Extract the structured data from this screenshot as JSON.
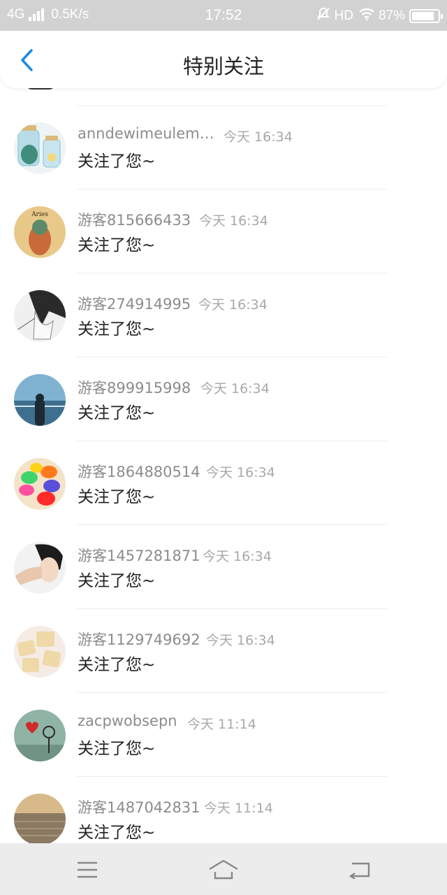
{
  "status_bar": {
    "network": "4G",
    "speed": "0.5K/s",
    "time": "17:52",
    "hd": "HD",
    "battery": "87%",
    "battery_level": 0.87
  },
  "header": {
    "title": "特别关注",
    "back_icon": "chevron-left-icon",
    "accent": "#1a8ce8"
  },
  "notifications": [
    {
      "name": "anndewimeulem…",
      "time": "今天 16:34",
      "message": "关注了您~"
    },
    {
      "name": "游客815666433",
      "time": "今天 16:34",
      "message": "关注了您~"
    },
    {
      "name": "游客274914995",
      "time": "今天 16:34",
      "message": "关注了您~"
    },
    {
      "name": "游客899915998",
      "time": "今天 16:34",
      "message": "关注了您~"
    },
    {
      "name": "游客1864880514",
      "time": "今天 16:34",
      "message": "关注了您~"
    },
    {
      "name": "游客1457281871",
      "time": "今天 16:34",
      "message": "关注了您~"
    },
    {
      "name": "游客1129749692",
      "time": "今天 16:34",
      "message": "关注了您~"
    },
    {
      "name": "zacpwobsepn",
      "time": "今天 11:14",
      "message": "关注了您~"
    },
    {
      "name": "游客1487042831",
      "time": "今天 11:14",
      "message": "关注了您~"
    }
  ],
  "navbar": {
    "menu_icon": "menu-icon",
    "home_icon": "home-icon",
    "back_icon": "return-icon"
  }
}
